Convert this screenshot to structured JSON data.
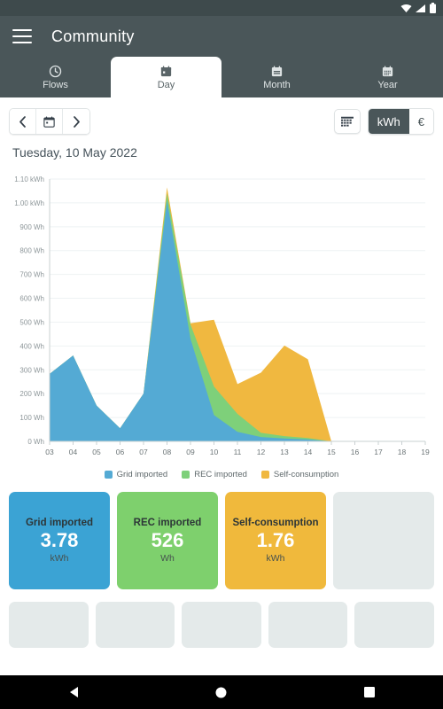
{
  "status_bar": {
    "icons": [
      "wifi-icon",
      "signal-icon",
      "battery-icon"
    ]
  },
  "app_bar": {
    "menu_icon": "hamburger-menu-icon",
    "title": "Community"
  },
  "tabs": [
    {
      "label": "Flows",
      "icon": "clock-gauge-icon",
      "active": false
    },
    {
      "label": "Day",
      "icon": "calendar-day-icon",
      "active": true
    },
    {
      "label": "Month",
      "icon": "calendar-month-icon",
      "active": false
    },
    {
      "label": "Year",
      "icon": "calendar-year-icon",
      "active": false
    }
  ],
  "toolbar": {
    "prev_label": "‹",
    "calendar_icon": "calendar-picker-icon",
    "next_label": "›",
    "table_icon": "table-grid-icon",
    "unit_kwh": "kWh",
    "unit_currency": "€",
    "selected_unit": "kWh"
  },
  "date_label": "Tuesday, 10 May 2022",
  "chart_data": {
    "type": "area",
    "title": "",
    "xlabel": "",
    "ylabel": "",
    "stacked": true,
    "grid": true,
    "legend_position": "bottom",
    "unit": "Wh",
    "x": [
      "03",
      "04",
      "05",
      "06",
      "07",
      "08",
      "09",
      "10",
      "11",
      "12",
      "13",
      "14",
      "15",
      "16",
      "17",
      "18",
      "19"
    ],
    "ylim": [
      0,
      1100
    ],
    "yticks": [
      0,
      100,
      200,
      300,
      400,
      500,
      600,
      700,
      800,
      900,
      1000,
      1100
    ],
    "ytick_labels": [
      "0 Wh",
      "100 Wh",
      "200 Wh",
      "300 Wh",
      "400 Wh",
      "500 Wh",
      "600 Wh",
      "700 Wh",
      "800 Wh",
      "900 Wh",
      "1.00 kWh",
      "1.10 kWh"
    ],
    "series": [
      {
        "name": "Grid imported",
        "color": "#54aad4",
        "values": [
          283,
          360,
          150,
          55,
          200,
          1010,
          430,
          110,
          40,
          18,
          12,
          8,
          0,
          0,
          0,
          0,
          0
        ]
      },
      {
        "name": "REC imported",
        "color": "#7ed07a",
        "values": [
          0,
          0,
          0,
          0,
          0,
          30,
          60,
          120,
          75,
          18,
          10,
          6,
          0,
          0,
          0,
          0,
          0
        ]
      },
      {
        "name": "Self-consumption",
        "color": "#f0b840",
        "values": [
          0,
          0,
          0,
          0,
          0,
          25,
          5,
          280,
          125,
          252,
          380,
          330,
          0,
          0,
          0,
          0,
          0
        ]
      }
    ]
  },
  "summary_cards": [
    {
      "title": "Grid imported",
      "value": "3.78",
      "unit": "kWh",
      "color": "#3ba3d4"
    },
    {
      "title": "REC imported",
      "value": "526",
      "unit": "Wh",
      "color": "#7ed06d"
    },
    {
      "title": "Self-consumption",
      "value": "1.76",
      "unit": "kWh",
      "color": "#f0b93c"
    },
    {
      "title": "",
      "value": "",
      "unit": "",
      "color": "#e4eaea"
    }
  ],
  "placeholder_cards": 5,
  "nav_bar": {
    "back_icon": "triangle-back-icon",
    "home_icon": "circle-home-icon",
    "recents_icon": "square-recents-icon"
  }
}
